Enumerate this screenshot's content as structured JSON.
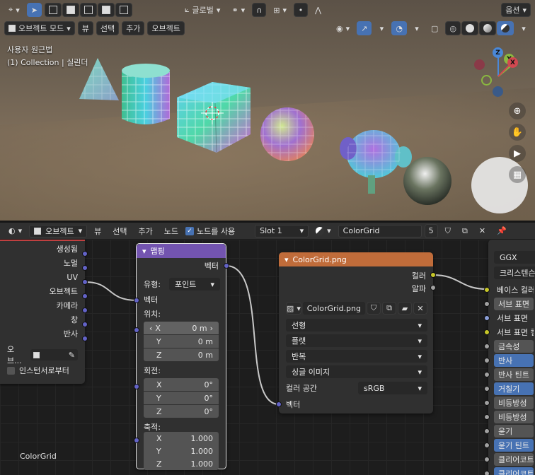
{
  "viewport": {
    "header": {
      "transform_label": "글로벌",
      "options_label": "옵션"
    },
    "mode_label": "오브젝트 모드",
    "menus": [
      "뷰",
      "선택",
      "추가",
      "오브젝트"
    ],
    "overlay": {
      "view_name": "사용자 원근법",
      "collection_info": "(1) Collection | 실린더"
    },
    "gizmo": {
      "z": "Z",
      "y": "Y",
      "x": "X"
    }
  },
  "node_editor": {
    "header": {
      "type_label": "오브젝트",
      "menus": [
        "뷰",
        "선택",
        "추가",
        "노드"
      ],
      "use_nodes_label": "노드를 사용",
      "slot_label": "Slot 1",
      "material_name": "ColorGrid",
      "user_count": "5"
    },
    "texcoord_node": {
      "outputs": [
        "생성됨",
        "노멀",
        "UV",
        "오브젝트",
        "카메라",
        "창",
        "반사"
      ],
      "object_label": "오브...",
      "instancer_label": "인스턴서로부터"
    },
    "mapping_node": {
      "title": "맵핑",
      "vector_out": "벡터",
      "type_label": "유형:",
      "type_value": "포인트",
      "vector_in": "벡터",
      "location_label": "위치:",
      "location": [
        {
          "axis": "X",
          "value": "0 m"
        },
        {
          "axis": "Y",
          "value": "0 m"
        },
        {
          "axis": "Z",
          "value": "0 m"
        }
      ],
      "rotation_label": "회전:",
      "rotation": [
        {
          "axis": "X",
          "value": "0°"
        },
        {
          "axis": "Y",
          "value": "0°"
        },
        {
          "axis": "Z",
          "value": "0°"
        }
      ],
      "scale_label": "축적:",
      "scale": [
        {
          "axis": "X",
          "value": "1.000"
        },
        {
          "axis": "Y",
          "value": "1.000"
        },
        {
          "axis": "Z",
          "value": "1.000"
        }
      ]
    },
    "image_node": {
      "title": "ColorGrid.png",
      "color_out": "컬러",
      "alpha_out": "알파",
      "image_name": "ColorGrid.png",
      "interpolation": "선형",
      "projection": "플랫",
      "extension": "반복",
      "source": "싱글 이미지",
      "colorspace_label": "컬러 공간",
      "colorspace_value": "sRGB",
      "vector_in": "벡터"
    },
    "bsdf_node": {
      "distribution": "GGX",
      "subsurface_method": "크리스텐슨",
      "inputs": [
        {
          "label": "베이스 컬러",
          "style": "plain"
        },
        {
          "label": "서브 표면",
          "style": "field"
        },
        {
          "label": "서브 표면",
          "style": "plain"
        },
        {
          "label": "서브 표면 컬",
          "style": "plain"
        },
        {
          "label": "금속성",
          "style": "field"
        },
        {
          "label": "반사",
          "style": "blue"
        },
        {
          "label": "반사 틴트",
          "style": "field"
        },
        {
          "label": "거칠기",
          "style": "blue"
        },
        {
          "label": "비등방성",
          "style": "field"
        },
        {
          "label": "비등방성",
          "style": "field"
        },
        {
          "label": "윤기",
          "style": "field"
        },
        {
          "label": "윤기 틴트",
          "style": "blue"
        },
        {
          "label": "클리어코트",
          "style": "field"
        },
        {
          "label": "클리어코트",
          "style": "blue"
        }
      ]
    },
    "frame_label": "ColorGrid"
  },
  "colors": {
    "accent": "#4772b3",
    "mapping_header": "#7354b0",
    "texture_header": "#c06c3a",
    "socket_vector": "#6363c7",
    "socket_color": "#c7c729"
  }
}
